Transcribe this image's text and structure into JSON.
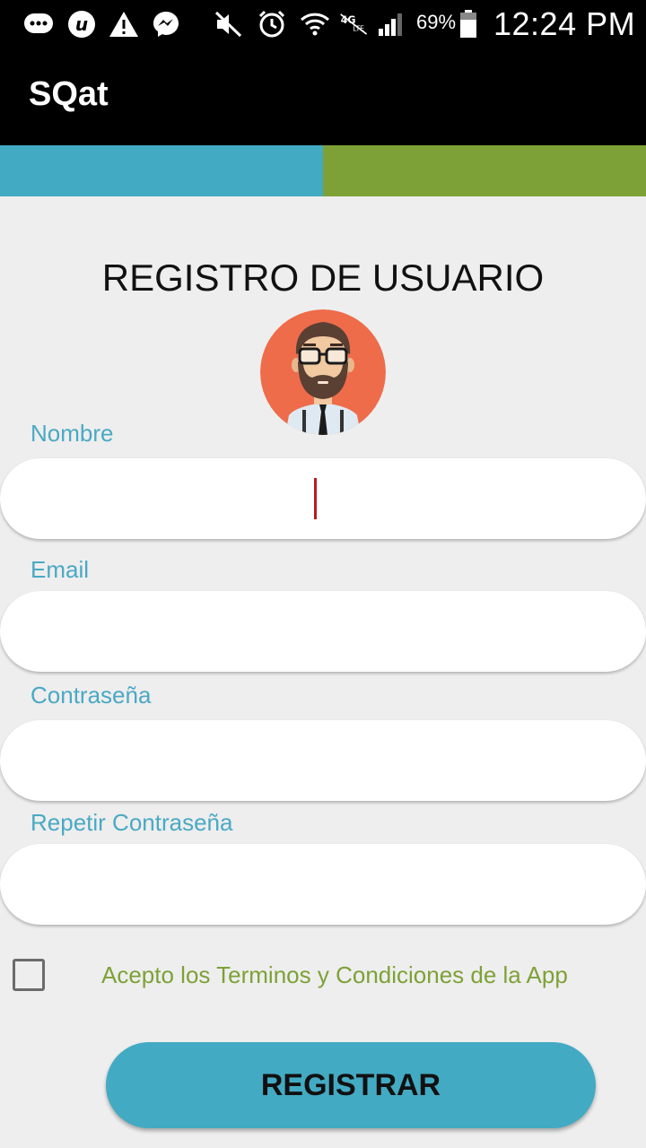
{
  "status_bar": {
    "icons": [
      "chat-icon",
      "u-icon",
      "warning-icon",
      "messenger-icon",
      "mute-icon",
      "alarm-icon",
      "wifi-icon",
      "lte-icon",
      "signal-icon",
      "battery-icon"
    ],
    "battery": "69%",
    "time": "12:24 PM"
  },
  "app_bar": {
    "title": "SQat"
  },
  "colors": {
    "accent_blue": "#43aac3",
    "accent_green": "#7ea137",
    "caret_red": "#b71c1c"
  },
  "page": {
    "heading": "REGISTRO DE USUARIO"
  },
  "form": {
    "name_label": "Nombre",
    "name_value": "",
    "email_label": "Email",
    "email_value": "",
    "password_label": "Contraseña",
    "password_value": "",
    "repeat_password_label": "Repetir Contraseña",
    "repeat_password_value": "",
    "terms_label": "Acepto los Terminos y Condiciones de la App",
    "terms_checked": false,
    "submit_label": "REGISTRAR"
  }
}
